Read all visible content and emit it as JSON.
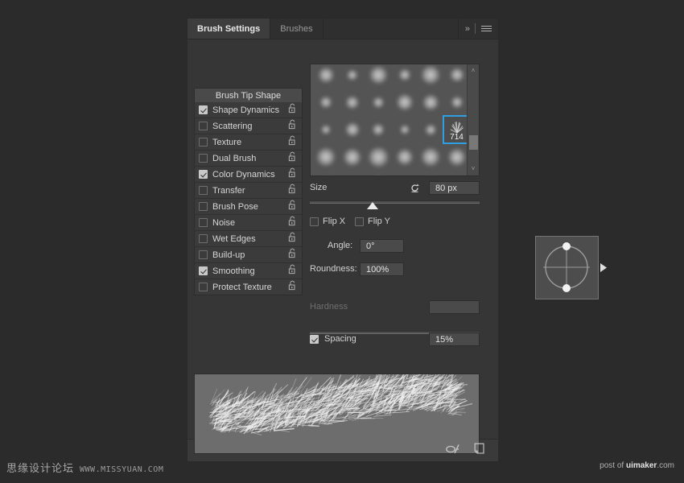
{
  "window": {
    "background_color": "#2b2b2b"
  },
  "panel": {
    "tabs": [
      {
        "label": "Brush Settings",
        "active": true
      },
      {
        "label": "Brushes",
        "active": false
      }
    ],
    "collapse_icon": "»",
    "menu_icon": "hamburger-menu-icon",
    "brushes_button": "Brushes"
  },
  "options": {
    "header": "Brush Tip Shape",
    "items": [
      {
        "label": "Shape Dynamics",
        "checked": true
      },
      {
        "label": "Scattering",
        "checked": false
      },
      {
        "label": "Texture",
        "checked": false
      },
      {
        "label": "Dual Brush",
        "checked": false
      },
      {
        "label": "Color Dynamics",
        "checked": true
      },
      {
        "label": "Transfer",
        "checked": false
      },
      {
        "label": "Brush Pose",
        "checked": false
      },
      {
        "label": "Noise",
        "checked": false
      },
      {
        "label": "Wet Edges",
        "checked": false
      },
      {
        "label": "Build-up",
        "checked": false
      },
      {
        "label": "Smoothing",
        "checked": true
      },
      {
        "label": "Protect Texture",
        "checked": false
      }
    ],
    "lock_icon": "unlocked-padlock-icon"
  },
  "brush_grid": {
    "selected_preset_number": "714",
    "selection_color": "#2e9fe0",
    "scrollbar": {
      "up_arrow": "˄",
      "down_arrow": "˅"
    }
  },
  "controls": {
    "size": {
      "label": "Size",
      "value": "80 px",
      "reset_icon": "reset-arrow-icon",
      "slider_percent": 37
    },
    "flip_x": {
      "label": "Flip X",
      "checked": false
    },
    "flip_y": {
      "label": "Flip Y",
      "checked": false
    },
    "angle": {
      "label": "Angle:",
      "value": "0°"
    },
    "roundness": {
      "label": "Roundness:",
      "value": "100%"
    },
    "hardness": {
      "label": "Hardness",
      "value": "",
      "enabled": false,
      "slider_percent": 0
    },
    "spacing": {
      "label": "Spacing",
      "checked": true,
      "value": "15%",
      "slider_percent": 7
    }
  },
  "footer": {
    "toggle_brush_icon": "brush-pressure-toggle-icon",
    "new_brush_icon": "new-brush-preset-icon"
  },
  "watermarks": {
    "left_cn": "思缘设计论坛",
    "left_url": "WWW.MISSYUAN.COM",
    "right_prefix": "post of ",
    "right_brand": "uimaker",
    "right_suffix": ".com"
  }
}
